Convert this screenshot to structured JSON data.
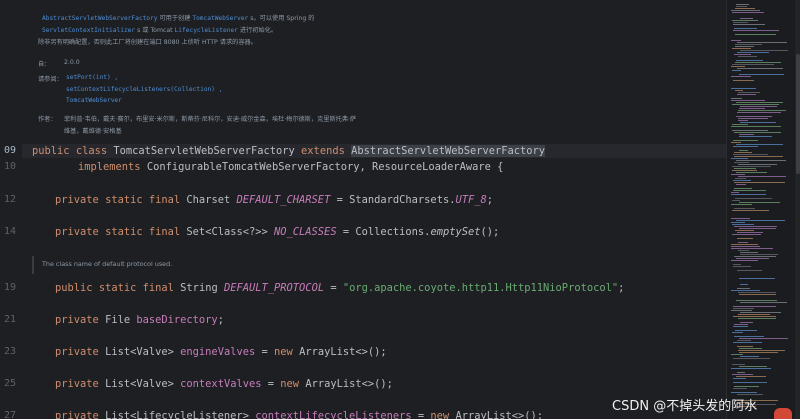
{
  "javadoc": {
    "line1_a": "AbstractServletWebServerFactory",
    "line1_b": " 可用于创建 ",
    "line1_c": "TomcatWebServer",
    "line1_d": " s。可以使用 Spring 的",
    "line2_a": "ServletContextInitializer",
    "line2_b": " s 或 Tomcat ",
    "line2_c": "LifecycleListener",
    "line2_d": " 进行初始化。",
    "line3": "除非另有明确配置，否则此工厂将创建在端口 8080 上侦听 HTTP 请求的容器。",
    "since_label": "自：",
    "since_value": "2.0.0",
    "see_label": "请参阅：",
    "see_1": "setPort(int) ,",
    "see_2": "setContextLifecycleListeners(Collection) ,",
    "see_3": "TomcatWebServer",
    "author_label": "作者：",
    "author_1": "菲利普·韦伯，戴夫·赛尔，布里安·米尔斯，斯蒂芬·尼科尔，安迪·威尔金森，埃杜·梅尔德斯，克里斯托弗·萨",
    "author_2": "维基，戴维德·安格基"
  },
  "inline_doc": "The class name of default protocol used.",
  "gutter": {
    "l109": "09",
    "l110": "10",
    "l112": "12",
    "l114": "14",
    "l119": "19",
    "l121": "21",
    "l123": "23",
    "l125": "25",
    "l127": "27"
  },
  "code": {
    "public": "public",
    "class": "class",
    "extends": "extends",
    "implements": "implements",
    "private": "private",
    "static": "static",
    "final": "final",
    "new": "new",
    "class_name": "TomcatServletWebServerFactory",
    "super_class": "AbstractServletWebServerFactory",
    "iface1": "ConfigurableTomcatWebServerFactory",
    "iface2": "ResourceLoaderAware",
    "brace": "{",
    "charset_type": "Charset",
    "default_charset": "DEFAULT_CHARSET",
    "std_charsets": "StandardCharsets.",
    "utf8": "UTF_8",
    "set_type": "Set<Class<?>>",
    "no_classes": "NO_CLASSES",
    "collections": "Collections.",
    "empty_set": "emptySet",
    "string_type": "String",
    "default_protocol": "DEFAULT_PROTOCOL",
    "protocol_value": "\"org.apache.coyote.http11.Http11NioProtocol\"",
    "file_type": "File",
    "base_directory": "baseDirectory",
    "list_valve": "List<Valve>",
    "engine_valves": "engineValves",
    "context_valves": "contextValves",
    "array_list": "ArrayList<>()",
    "list_lifecycle": "List<LifecycleListener>",
    "context_listeners": "contextLifecycleListeners",
    "array_list_partial": "ArrayList<>();"
  },
  "watermark": "CSDN @不掉头发的阿水",
  "colors": {
    "background": "#1e1f22",
    "keyword": "#cf8e6d",
    "constant": "#c77dbb",
    "string": "#6aab73",
    "doc_link": "#4e8ed6"
  }
}
